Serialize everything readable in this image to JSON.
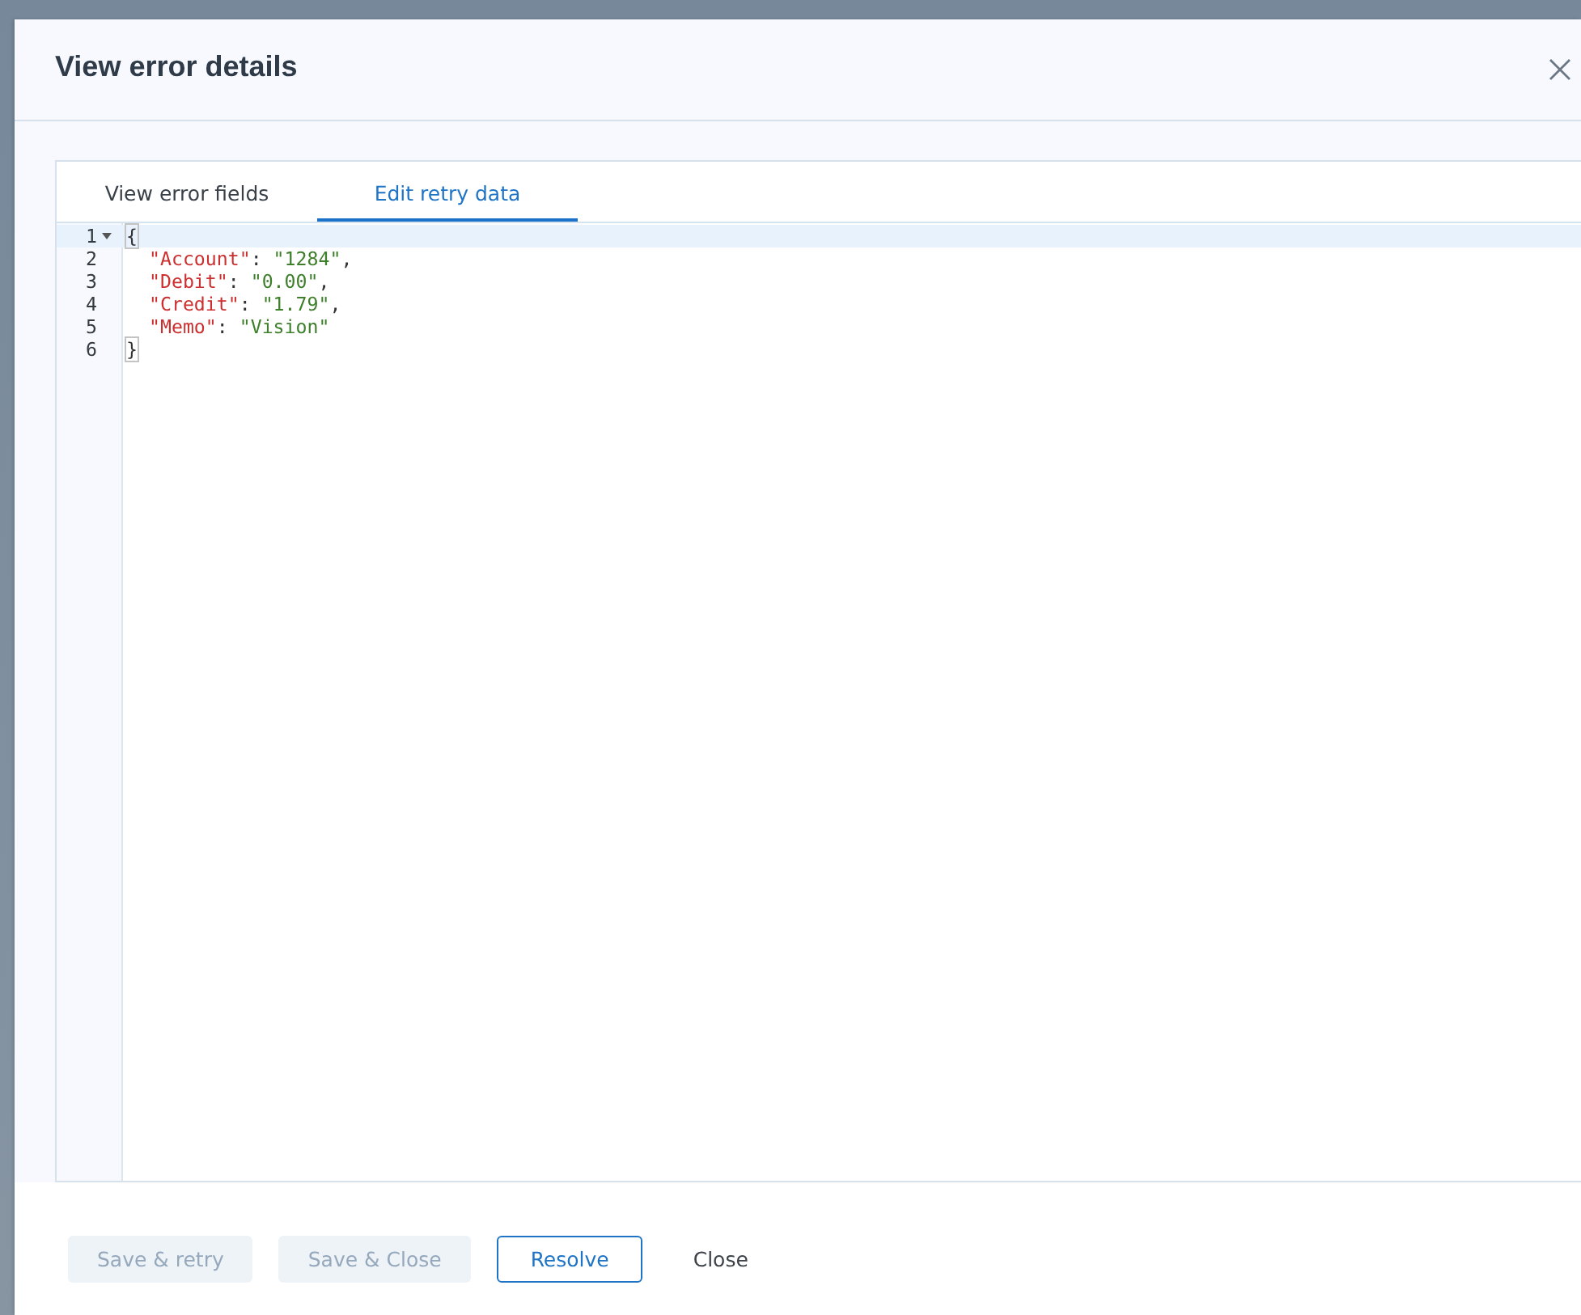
{
  "dialog": {
    "title": "View error details"
  },
  "tabs": [
    {
      "label": "View error fields",
      "selected": false
    },
    {
      "label": "Edit retry data",
      "selected": true
    }
  ],
  "editor": {
    "lines": [
      {
        "number": "1",
        "foldable": true,
        "active": true,
        "tokens": [
          {
            "kind": "bracket",
            "text": "{"
          }
        ],
        "children": [
          {
            "number": "2",
            "foldable": false,
            "active": false,
            "tokens": [
              {
                "kind": "key",
                "text": "\"Account\""
              },
              {
                "kind": "punct",
                "text": ": "
              },
              {
                "kind": "string",
                "text": "\"1284\""
              },
              {
                "kind": "punct",
                "text": ","
              }
            ]
          },
          {
            "number": "3",
            "foldable": false,
            "active": false,
            "tokens": [
              {
                "kind": "key",
                "text": "\"Debit\""
              },
              {
                "kind": "punct",
                "text": ": "
              },
              {
                "kind": "string",
                "text": "\"0.00\""
              },
              {
                "kind": "punct",
                "text": ","
              }
            ]
          },
          {
            "number": "4",
            "foldable": false,
            "active": false,
            "tokens": [
              {
                "kind": "key",
                "text": "\"Credit\""
              },
              {
                "kind": "punct",
                "text": ": "
              },
              {
                "kind": "string",
                "text": "\"1.79\""
              },
              {
                "kind": "punct",
                "text": ","
              }
            ]
          },
          {
            "number": "5",
            "foldable": false,
            "active": false,
            "tokens": [
              {
                "kind": "key",
                "text": "\"Memo\""
              },
              {
                "kind": "punct",
                "text": ": "
              },
              {
                "kind": "string",
                "text": "\"Vision\""
              }
            ]
          }
        ]
      },
      {
        "number": "6",
        "foldable": false,
        "active": false,
        "tokens": [
          {
            "kind": "bracket",
            "text": "}"
          }
        ]
      }
    ]
  },
  "buttons": [
    {
      "label": "Save & retry",
      "kind": "filled",
      "disabled": true
    },
    {
      "label": "Save & Close",
      "kind": "filled",
      "disabled": true
    },
    {
      "label": "Resolve",
      "kind": "outline",
      "disabled": false
    },
    {
      "label": "Close",
      "kind": "text",
      "disabled": false
    }
  ]
}
